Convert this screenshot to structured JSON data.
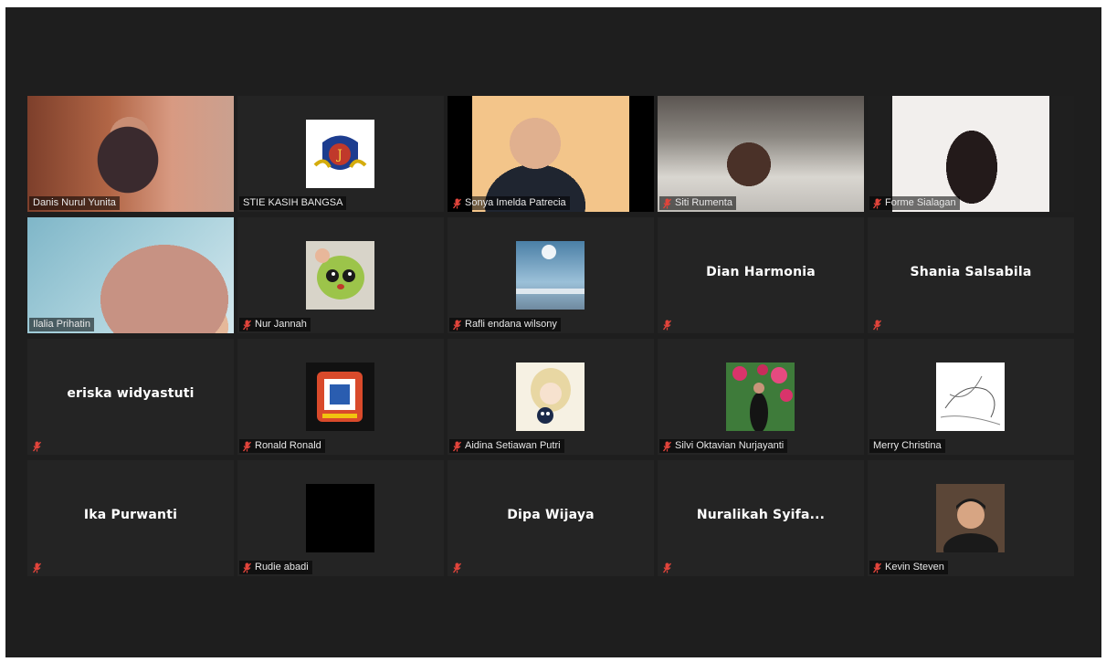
{
  "colors": {
    "background": "#1e1e1e",
    "tile": "#242424",
    "active_border": "#c6e36a",
    "muted_icon": "#e0443b"
  },
  "participants": [
    {
      "name": "Danis Nurul Yunita",
      "muted": false,
      "kind": "video",
      "active": true
    },
    {
      "name": "STIE KASIH BANGSA",
      "muted": false,
      "kind": "picture",
      "picture": "logo-emblem"
    },
    {
      "name": "Sonya Imelda Patrecia",
      "muted": true,
      "kind": "video"
    },
    {
      "name": "Siti Rumenta",
      "muted": true,
      "kind": "video"
    },
    {
      "name": "Forme Sialagan",
      "muted": true,
      "kind": "video"
    },
    {
      "name": "Ilalia Prihatin",
      "muted": false,
      "kind": "video"
    },
    {
      "name": "Nur Jannah",
      "muted": true,
      "kind": "picture",
      "picture": "cartoon-avatar"
    },
    {
      "name": "Rafli endana wilsony",
      "muted": true,
      "kind": "picture",
      "picture": "sky-photo"
    },
    {
      "name": "",
      "display_name": "Dian Harmonia",
      "muted": true,
      "kind": "name"
    },
    {
      "name": "",
      "display_name": "Shania Salsabila",
      "muted": true,
      "kind": "name"
    },
    {
      "name": "",
      "display_name": "eriska widyastuti",
      "muted": true,
      "kind": "name"
    },
    {
      "name": "Ronald Ronald",
      "muted": true,
      "kind": "picture",
      "picture": "badge-logo"
    },
    {
      "name": "Aidina Setiawan Putri",
      "muted": true,
      "kind": "picture",
      "picture": "anime-picture"
    },
    {
      "name": "Silvi Oktavian Nurjayanti",
      "muted": true,
      "kind": "picture",
      "picture": "flowers-photo"
    },
    {
      "name": "Merry Christina",
      "muted": false,
      "kind": "picture",
      "picture": "sketch-drawing"
    },
    {
      "name": "",
      "display_name": "Ika Purwanti",
      "muted": true,
      "kind": "name"
    },
    {
      "name": "Rudie abadi",
      "muted": true,
      "kind": "picture",
      "picture": "black-square"
    },
    {
      "name": "",
      "display_name": "Dipa Wijaya",
      "muted": true,
      "kind": "name"
    },
    {
      "name": "",
      "display_name": "Nuralikah Syifa...",
      "muted": true,
      "kind": "name"
    },
    {
      "name": "Kevin Steven",
      "muted": true,
      "kind": "picture",
      "picture": "portrait-photo"
    }
  ]
}
